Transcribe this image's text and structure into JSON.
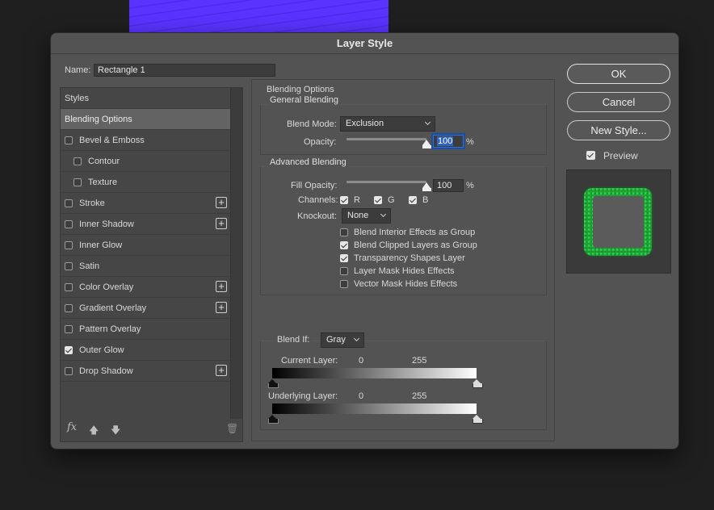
{
  "dialog": {
    "title": "Layer Style",
    "name_label": "Name:",
    "name_value": "Rectangle 1"
  },
  "styles_list": {
    "header": "Styles",
    "items": [
      {
        "label": "Blending Options",
        "checkbox": false,
        "checked": false,
        "plus": false,
        "active": true,
        "indent": 0
      },
      {
        "label": "Bevel & Emboss",
        "checkbox": true,
        "checked": false,
        "plus": false,
        "active": false,
        "indent": 0
      },
      {
        "label": "Contour",
        "checkbox": true,
        "checked": false,
        "plus": false,
        "active": false,
        "indent": 1
      },
      {
        "label": "Texture",
        "checkbox": true,
        "checked": false,
        "plus": false,
        "active": false,
        "indent": 1
      },
      {
        "label": "Stroke",
        "checkbox": true,
        "checked": false,
        "plus": true,
        "active": false,
        "indent": 0
      },
      {
        "label": "Inner Shadow",
        "checkbox": true,
        "checked": false,
        "plus": true,
        "active": false,
        "indent": 0
      },
      {
        "label": "Inner Glow",
        "checkbox": true,
        "checked": false,
        "plus": false,
        "active": false,
        "indent": 0
      },
      {
        "label": "Satin",
        "checkbox": true,
        "checked": false,
        "plus": false,
        "active": false,
        "indent": 0
      },
      {
        "label": "Color Overlay",
        "checkbox": true,
        "checked": false,
        "plus": true,
        "active": false,
        "indent": 0
      },
      {
        "label": "Gradient Overlay",
        "checkbox": true,
        "checked": false,
        "plus": true,
        "active": false,
        "indent": 0
      },
      {
        "label": "Pattern Overlay",
        "checkbox": true,
        "checked": false,
        "plus": false,
        "active": false,
        "indent": 0
      },
      {
        "label": "Outer Glow",
        "checkbox": true,
        "checked": true,
        "plus": false,
        "active": false,
        "indent": 0
      },
      {
        "label": "Drop Shadow",
        "checkbox": true,
        "checked": false,
        "plus": true,
        "active": false,
        "indent": 0
      }
    ],
    "footer": {
      "fx": "fx",
      "up_arrow": "🡅",
      "down_arrow": "🡇",
      "trash": "🗑"
    }
  },
  "blending": {
    "section_title": "Blending Options",
    "general": {
      "title": "General Blending",
      "blend_mode_label": "Blend Mode:",
      "blend_mode_value": "Exclusion",
      "opacity_label": "Opacity:",
      "opacity_value": "100",
      "opacity_level": 1.0,
      "percent": "%"
    },
    "advanced": {
      "title": "Advanced Blending",
      "fill_opacity_label": "Fill Opacity:",
      "fill_opacity_value": "100",
      "fill_opacity_level": 1.0,
      "percent": "%",
      "channels_label": "Channels:",
      "channel_r": "R",
      "channel_g": "G",
      "channel_b": "B",
      "knockout_label": "Knockout:",
      "knockout_value": "None",
      "options": [
        {
          "label": "Blend Interior Effects as Group",
          "checked": false
        },
        {
          "label": "Blend Clipped Layers as Group",
          "checked": true
        },
        {
          "label": "Transparency Shapes Layer",
          "checked": true
        },
        {
          "label": "Layer Mask Hides Effects",
          "checked": false
        },
        {
          "label": "Vector Mask Hides Effects",
          "checked": false
        }
      ]
    },
    "blend_if": {
      "label": "Blend If:",
      "value": "Gray",
      "current_label": "Current Layer:",
      "current_low": "0",
      "current_high": "255",
      "underlying_label": "Underlying Layer:",
      "underlying_low": "0",
      "underlying_high": "255"
    }
  },
  "buttons": {
    "ok": "OK",
    "cancel": "Cancel",
    "new_style": "New Style...",
    "preview_label": "Preview",
    "preview_checked": true
  },
  "colors": {
    "accent": "#2f64c4",
    "glow": "#1ea637"
  }
}
